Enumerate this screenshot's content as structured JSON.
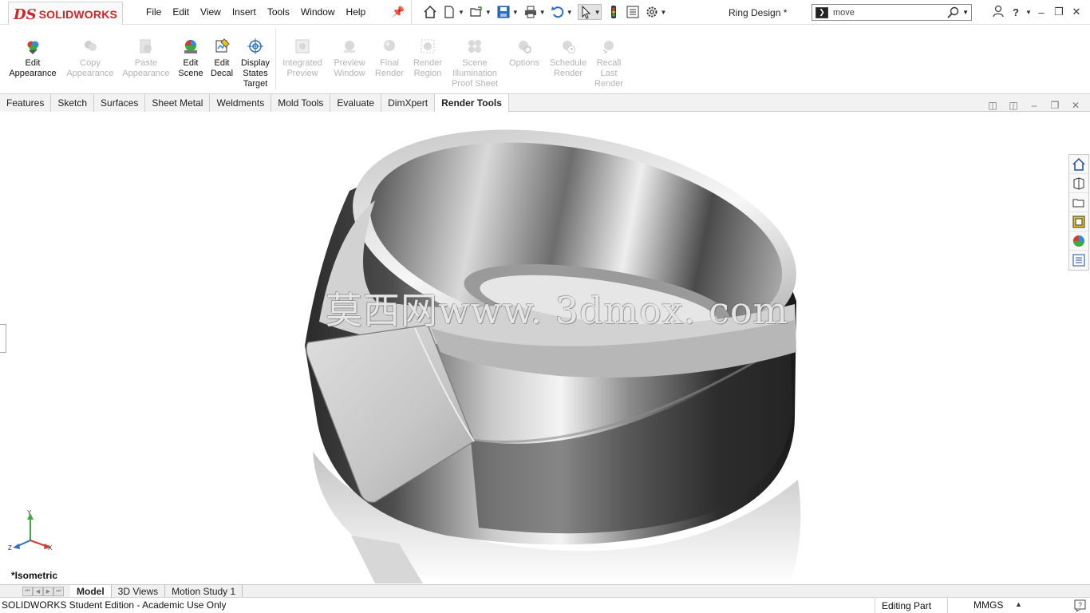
{
  "app": {
    "logo_mark": "DS",
    "logo_text": "SOLIDWORKS",
    "document_title": "Ring Design *"
  },
  "menu": [
    "File",
    "Edit",
    "View",
    "Insert",
    "Tools",
    "Window",
    "Help"
  ],
  "search": {
    "value": "move"
  },
  "ribbon": {
    "edit_appearance": "Edit Appearance",
    "copy_appearance": "Copy Appearance",
    "paste_appearance": "Paste Appearance",
    "edit_scene": "Edit Scene",
    "edit_decal": "Edit Decal",
    "display_states_target": "Display States Target",
    "integrated_preview": "Integrated Preview",
    "preview_window": "Preview Window",
    "final_render": "Final Render",
    "render_region": "Render Region",
    "scene_illumination": "Scene Illumination Proof Sheet",
    "options": "Options",
    "schedule_render": "Schedule Render",
    "recall_last_render": "Recall Last Render"
  },
  "tabs": [
    "Features",
    "Sketch",
    "Surfaces",
    "Sheet Metal",
    "Weldments",
    "Mold Tools",
    "Evaluate",
    "DimXpert",
    "Render Tools"
  ],
  "active_tab": "Render Tools",
  "viewport": {
    "watermark": "莫西网www. 3dmox. com",
    "view_orientation": "*Isometric",
    "triad_axes": [
      "Y",
      "Z",
      "X"
    ]
  },
  "bottom_tabs": [
    "Model",
    "3D Views",
    "Motion Study 1"
  ],
  "status": {
    "edition": "SOLIDWORKS Student Edition - Academic Use Only",
    "mode": "Editing Part",
    "units": "MMGS"
  },
  "colors": {
    "brand": "#d2232a",
    "accent_blue": "#2a6fd6",
    "tab_bar": "#f2f2f2"
  }
}
